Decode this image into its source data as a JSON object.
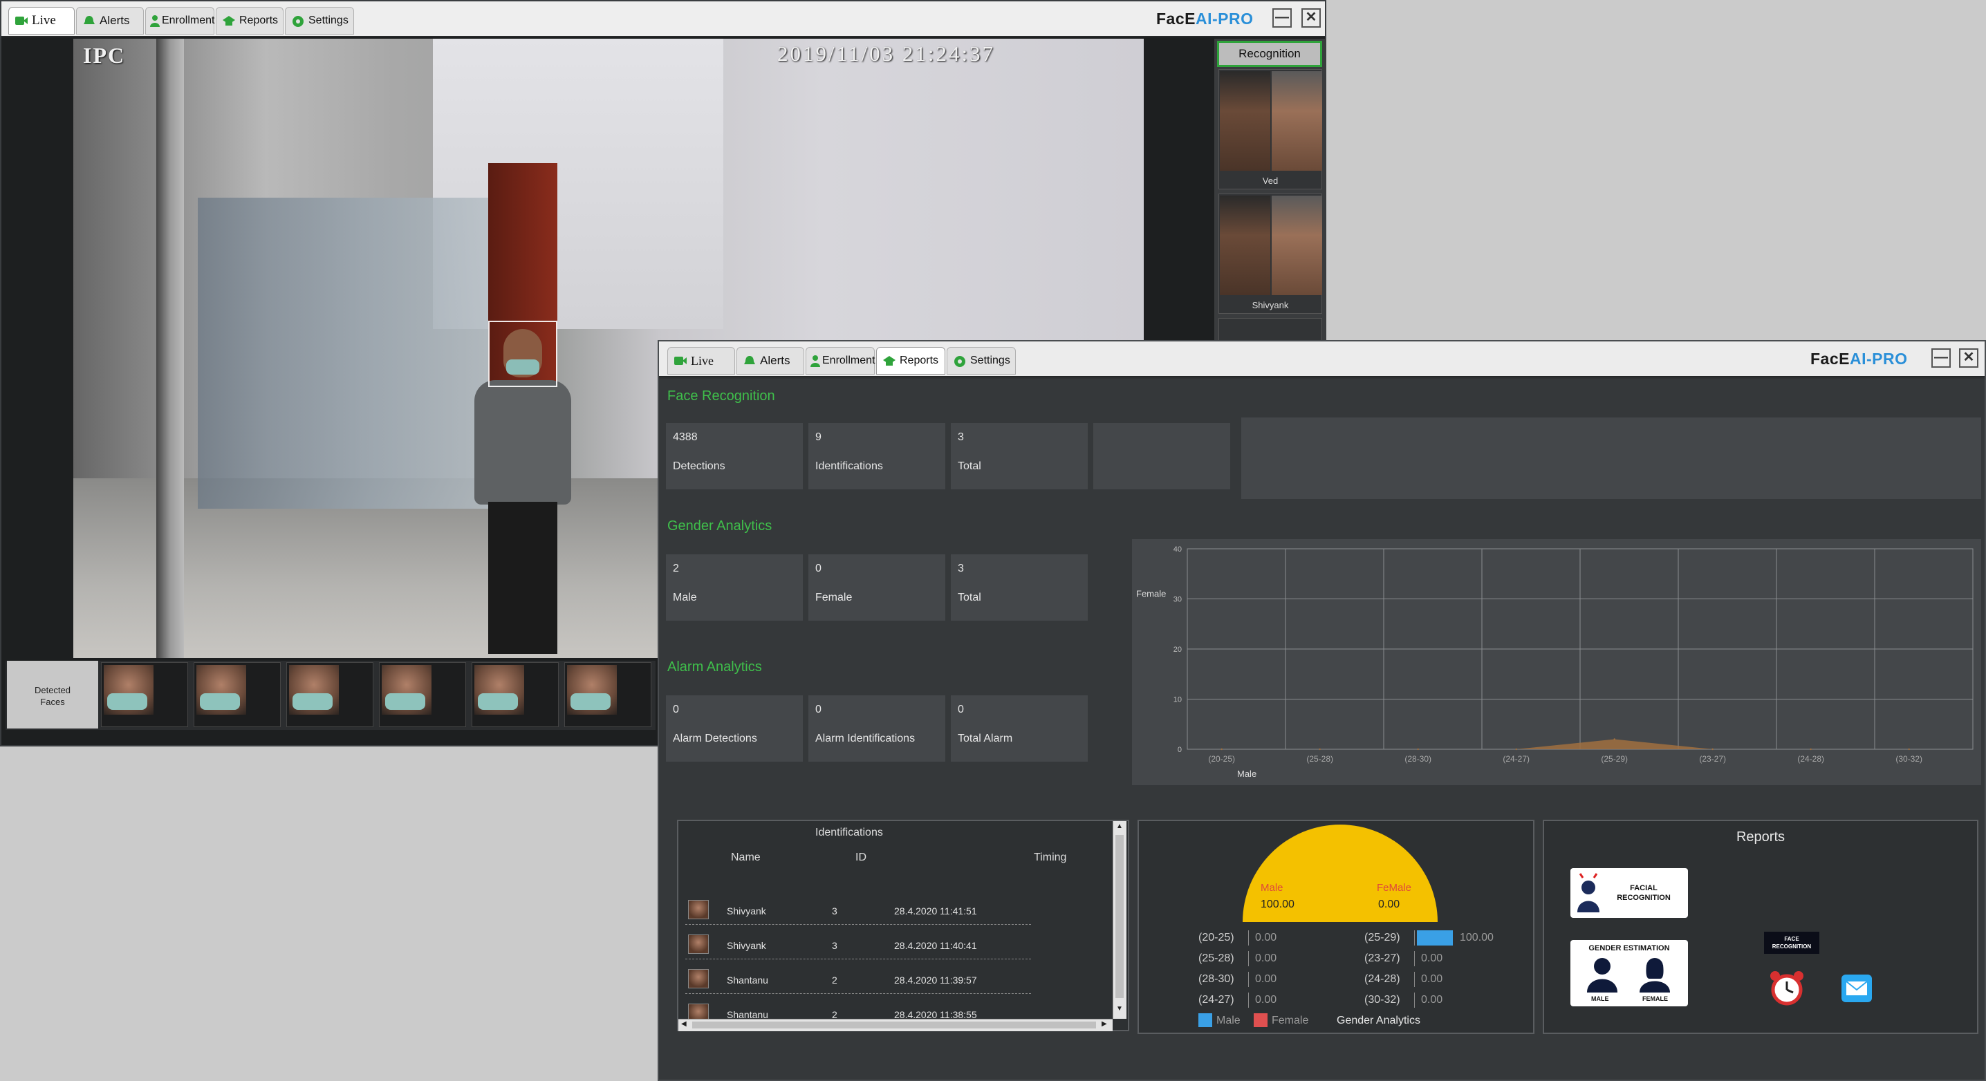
{
  "window1": {
    "tabs": [
      {
        "label": "Live"
      },
      {
        "label": "Alerts"
      },
      {
        "label": "Enrollment"
      },
      {
        "label": "Reports"
      },
      {
        "label": "Settings"
      }
    ],
    "brand_prefix": "FacE",
    "brand_suffix": "AI-PRO",
    "camera": {
      "name": "IPC",
      "timestamp": "2019/11/03  21:24:37"
    },
    "recognition": {
      "header": "Recognition",
      "cards": [
        {
          "name": "Ved"
        },
        {
          "name": "Shivyank"
        }
      ]
    },
    "detected_faces_label_1": "Detected",
    "detected_faces_label_2": "Faces"
  },
  "window2": {
    "tabs": [
      {
        "label": "Live"
      },
      {
        "label": "Alerts"
      },
      {
        "label": "Enrollment"
      },
      {
        "label": "Reports"
      },
      {
        "label": "Settings"
      }
    ],
    "brand_prefix": "FacE",
    "brand_suffix": "AI-PRO",
    "face_recognition": {
      "title": "Face Recognition",
      "cards": [
        {
          "value": "4388",
          "label": "Detections"
        },
        {
          "value": "9",
          "label": "Identifications"
        },
        {
          "value": "3",
          "label": "Total"
        }
      ]
    },
    "gender_analytics": {
      "title": "Gender Analytics",
      "cards": [
        {
          "value": "2",
          "label": "Male"
        },
        {
          "value": "0",
          "label": "Female"
        },
        {
          "value": "3",
          "label": "Total"
        }
      ]
    },
    "alarm_analytics": {
      "title": "Alarm Analytics",
      "cards": [
        {
          "value": "0",
          "label": "Alarm Detections"
        },
        {
          "value": "0",
          "label": "Alarm Identifications"
        },
        {
          "value": "0",
          "label": "Total Alarm"
        }
      ]
    },
    "identifications": {
      "title": "Identifications",
      "columns": [
        "Name",
        "ID",
        "Timing"
      ],
      "rows": [
        {
          "name": "Shivyank",
          "id": "3",
          "timing": "28.4.2020 11:41:51"
        },
        {
          "name": "Shivyank",
          "id": "3",
          "timing": "28.4.2020 11:40:41"
        },
        {
          "name": "Shantanu",
          "id": "2",
          "timing": "28.4.2020 11:39:57"
        },
        {
          "name": "Shantanu",
          "id": "2",
          "timing": "28.4.2020 11:38:55"
        }
      ]
    },
    "gender_summary": {
      "male_label": "Male",
      "male_value": "100.00",
      "female_label": "FeMale",
      "female_value": "0.00",
      "left": [
        {
          "range": "(20-25)",
          "value": "0.00"
        },
        {
          "range": "(25-28)",
          "value": "0.00"
        },
        {
          "range": "(28-30)",
          "value": "0.00"
        },
        {
          "range": "(24-27)",
          "value": "0.00"
        }
      ],
      "right": [
        {
          "range": "(25-29)",
          "value": "100.00",
          "bar": 1
        },
        {
          "range": "(23-27)",
          "value": "0.00",
          "bar": 0
        },
        {
          "range": "(24-28)",
          "value": "0.00",
          "bar": 0
        },
        {
          "range": "(30-32)",
          "value": "0.00",
          "bar": 0
        }
      ],
      "legend_male": "Male",
      "legend_female": "Female",
      "caption": "Gender Analytics",
      "colors": {
        "male": "#3aa0e6",
        "female": "#e05050",
        "gauge": "#f4c100"
      }
    },
    "reports": {
      "title": "Reports",
      "facial_recognition_1": "FACIAL",
      "facial_recognition_2": "RECOGNITION",
      "gender_estimation": "GENDER ESTIMATION",
      "male": "MALE",
      "female": "FEMALE",
      "face_1": "FACE",
      "face_2": "RECOGNITION"
    }
  },
  "chart_data": {
    "type": "area",
    "ylabel": "Female",
    "xlabel": "Male",
    "ylim": [
      0,
      40
    ],
    "yticks": [
      "40",
      "30",
      "20",
      "10",
      "0"
    ],
    "categories": [
      "(20-25)",
      "(25-28)",
      "(28-30)",
      "(24-27)",
      "(25-29)",
      "(23-27)",
      "(24-28)",
      "(30-32)"
    ],
    "series": [
      {
        "values": [
          0,
          0,
          0,
          0,
          2,
          0,
          0,
          0
        ],
        "color": "#a07040"
      }
    ],
    "grid": true
  }
}
